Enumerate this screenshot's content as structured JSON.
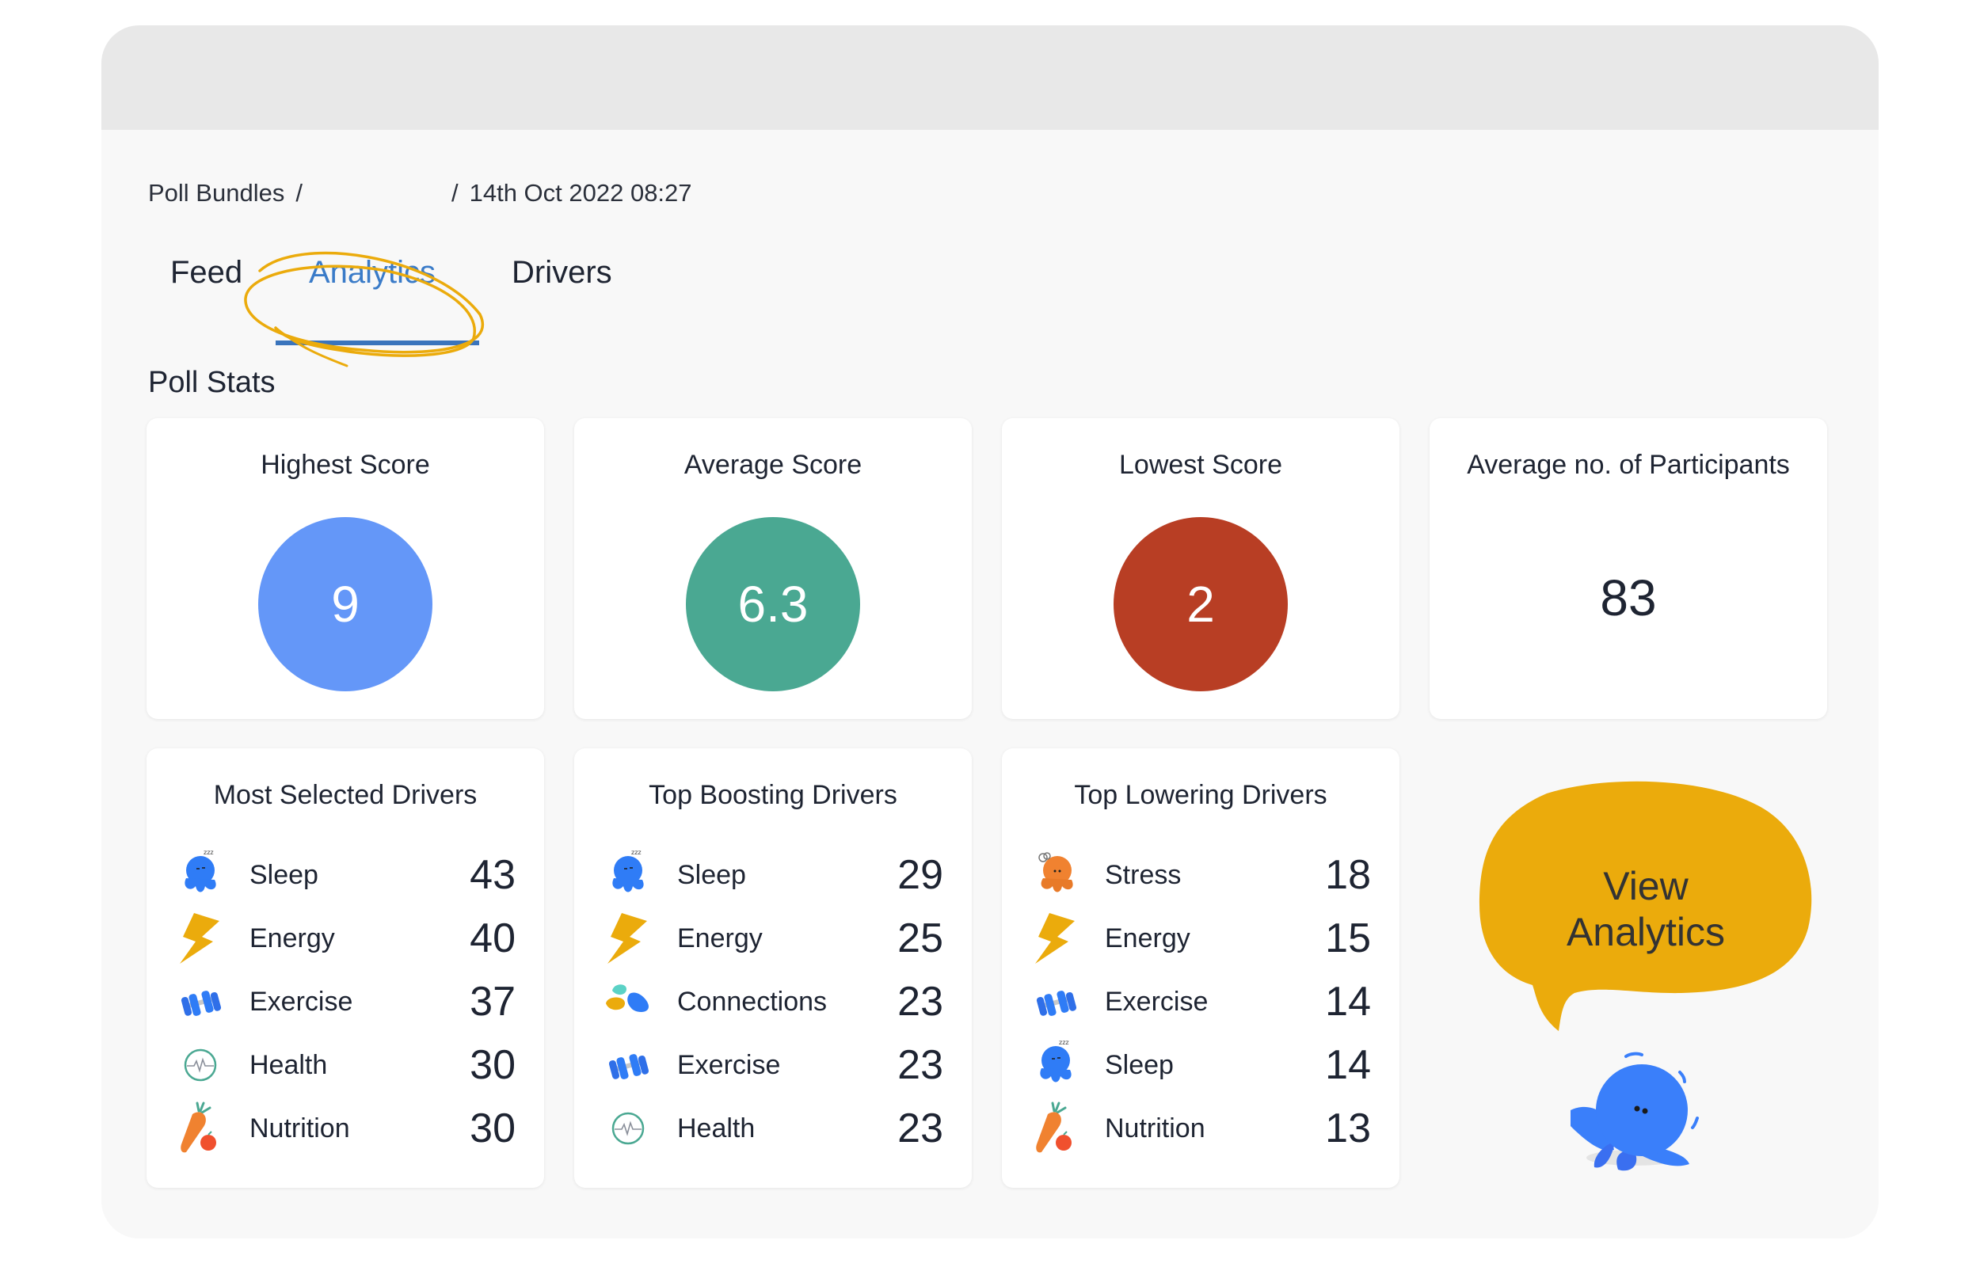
{
  "breadcrumb": {
    "root": "Poll Bundles",
    "separator": "/",
    "middle": "",
    "current": "14th Oct 2022 08:27"
  },
  "tabs": [
    {
      "label": "Feed",
      "active": false
    },
    {
      "label": "Analytics",
      "active": true
    },
    {
      "label": "Drivers",
      "active": false
    }
  ],
  "section_title": "Poll Stats",
  "stats": [
    {
      "title": "Highest Score",
      "value": "9",
      "color": "#6497f8"
    },
    {
      "title": "Average Score",
      "value": "6.3",
      "color": "#4aa892"
    },
    {
      "title": "Lowest Score",
      "value": "2",
      "color": "#b83e24"
    },
    {
      "title": "Average no. of Participants",
      "value": "83"
    }
  ],
  "driver_cards": [
    {
      "title": "Most Selected Drivers",
      "items": [
        {
          "name": "Sleep",
          "value": "43",
          "icon": "sleep-octopus-icon"
        },
        {
          "name": "Energy",
          "value": "40",
          "icon": "lightning-bolt-icon"
        },
        {
          "name": "Exercise",
          "value": "37",
          "icon": "dumbbell-icon"
        },
        {
          "name": "Health",
          "value": "30",
          "icon": "heartbeat-icon"
        },
        {
          "name": "Nutrition",
          "value": "30",
          "icon": "carrot-apple-icon"
        }
      ]
    },
    {
      "title": "Top Boosting Drivers",
      "items": [
        {
          "name": "Sleep",
          "value": "29",
          "icon": "sleep-octopus-icon"
        },
        {
          "name": "Energy",
          "value": "25",
          "icon": "lightning-bolt-icon"
        },
        {
          "name": "Connections",
          "value": "23",
          "icon": "connections-icon"
        },
        {
          "name": "Exercise",
          "value": "23",
          "icon": "dumbbell-icon"
        },
        {
          "name": "Health",
          "value": "23",
          "icon": "heartbeat-icon"
        }
      ]
    },
    {
      "title": "Top Lowering Drivers",
      "items": [
        {
          "name": "Stress",
          "value": "18",
          "icon": "stress-octopus-icon"
        },
        {
          "name": "Energy",
          "value": "15",
          "icon": "lightning-bolt-icon"
        },
        {
          "name": "Exercise",
          "value": "14",
          "icon": "dumbbell-icon"
        },
        {
          "name": "Sleep",
          "value": "14",
          "icon": "sleep-octopus-icon"
        },
        {
          "name": "Nutrition",
          "value": "13",
          "icon": "carrot-apple-icon"
        }
      ]
    }
  ],
  "callout": {
    "line1": "View",
    "line2": "Analytics",
    "color": "#ebab0c"
  },
  "colors": {
    "accent_tab": "#3a7bc8",
    "annotation": "#ebab0c",
    "mascot": "#3a7ffa"
  }
}
